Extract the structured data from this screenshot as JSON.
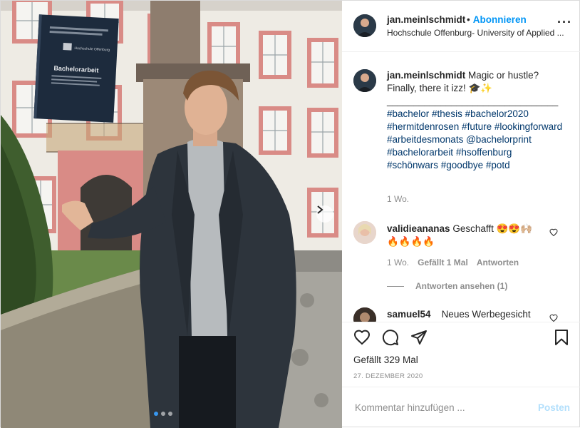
{
  "post": {
    "author": "jan.meinlschmidt",
    "follow_separator": "•",
    "follow_label": "Abonnieren",
    "location": "Hochschule Offenburg- University of Applied ...",
    "more_icon": "ellipsis-icon"
  },
  "photo": {
    "book_title": "Bachelorarbeit",
    "book_publisher": "Hochschule Offenburg",
    "carousel_total": 3,
    "carousel_active": 1
  },
  "caption": {
    "username": "jan.meinlschmidt",
    "text_line1": "Magic or hustle?",
    "text_line2": "Finally, there it izz! 🎓✨",
    "divider": "________________________________",
    "hashtags": "#bachelor #thesis #bachelor2020 #hermitdenrosen #future #lookingforward #arbeitdesmonats @bachelorprint #bachelorarbeit #hsoffenburg #schönwars #goodbye #potd",
    "time": "1 Wo."
  },
  "comments": [
    {
      "username": "validieananas",
      "text": "Geschafft 😍😍🙌🏼 🔥🔥🔥🔥",
      "time": "1 Wo.",
      "likes": "Gefällt 1 Mal",
      "reply": "Antworten",
      "view_replies": "Antworten ansehen (1)"
    },
    {
      "username": "samuel54",
      "text": "Neues Werbegesicht"
    }
  ],
  "actions": {
    "likes": "Gefällt 329 Mal",
    "date": "27. DEZEMBER 2020"
  },
  "composer": {
    "placeholder": "Kommentar hinzufügen ...",
    "post_label": "Posten"
  },
  "colors": {
    "link": "#0095f6",
    "hashtag": "#00376b",
    "muted": "#8e8e8e",
    "post_disabled": "#b2dffc"
  }
}
